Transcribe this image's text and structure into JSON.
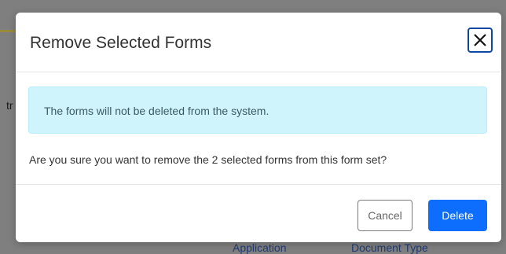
{
  "background": {
    "edge_text": "tr",
    "bottom_links": [
      "Application",
      "Document Type"
    ]
  },
  "modal": {
    "title": "Remove Selected Forms",
    "close_icon": "close-icon",
    "alert_text": "The forms will not be deleted from the system.",
    "confirm_text": "Are you sure you want to remove the 2 selected forms from this form set?",
    "cancel_label": "Cancel",
    "delete_label": "Delete"
  },
  "colors": {
    "overlay": "#7f7f7f",
    "alert_bg": "#cff4fc",
    "primary": "#0d6efd",
    "close_border": "#0d47a1"
  }
}
